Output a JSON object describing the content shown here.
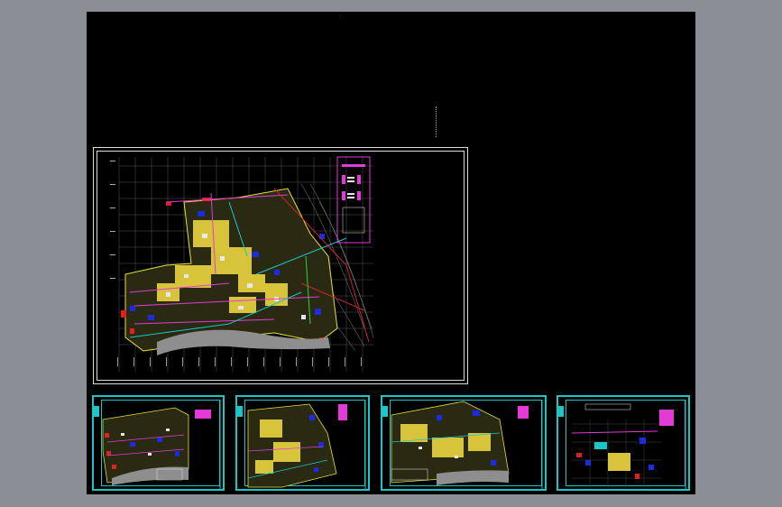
{
  "workspace": {
    "background_color": "#000000",
    "frame_color": "#8a8f96",
    "accent_cyan": "#19c6c8"
  },
  "sheets": [
    {
      "name": "main-site-plan"
    },
    {
      "name": "sheet-1"
    },
    {
      "name": "sheet-2"
    },
    {
      "name": "sheet-3"
    },
    {
      "name": "sheet-4"
    }
  ]
}
